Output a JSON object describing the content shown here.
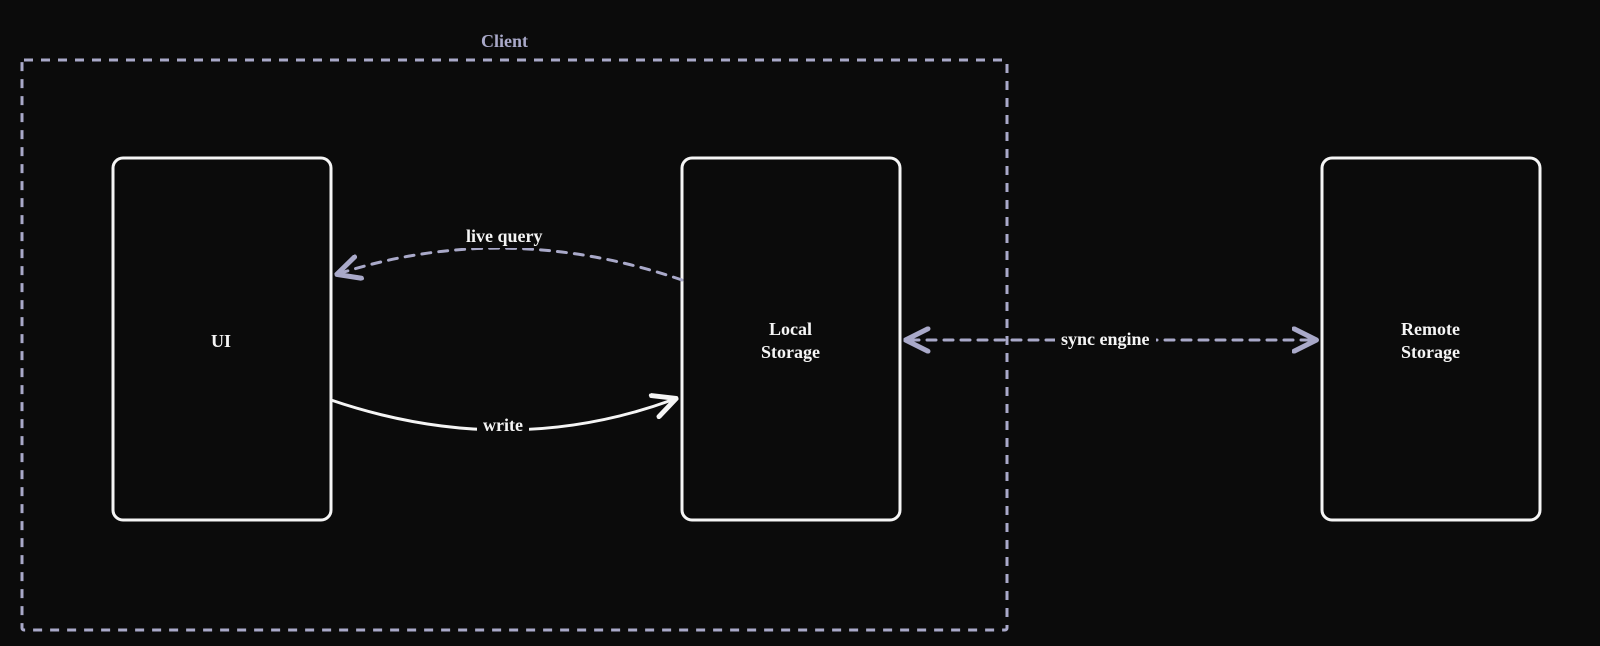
{
  "diagram": {
    "container_label": "Client",
    "nodes": {
      "ui": {
        "label": "UI"
      },
      "local_storage": {
        "label": "Local\nStorage"
      },
      "remote_storage": {
        "label": "Remote\nStorage"
      }
    },
    "edges": {
      "live_query": {
        "label": "live query",
        "from": "local_storage",
        "to": "ui",
        "style": "dashed",
        "direction": "one",
        "curve": "up"
      },
      "write": {
        "label": "write",
        "from": "ui",
        "to": "local_storage",
        "style": "solid",
        "direction": "one",
        "curve": "down"
      },
      "sync_engine": {
        "label": "sync engine",
        "from": "local_storage",
        "to": "remote_storage",
        "style": "dashed",
        "direction": "both",
        "curve": "straight"
      }
    },
    "colors": {
      "bg": "#0b0b0b",
      "box_stroke": "#f5f5f5",
      "dash_stroke": "#a9a9c9",
      "text": "#f5f5f5",
      "text_muted": "#a9a9c9"
    }
  }
}
